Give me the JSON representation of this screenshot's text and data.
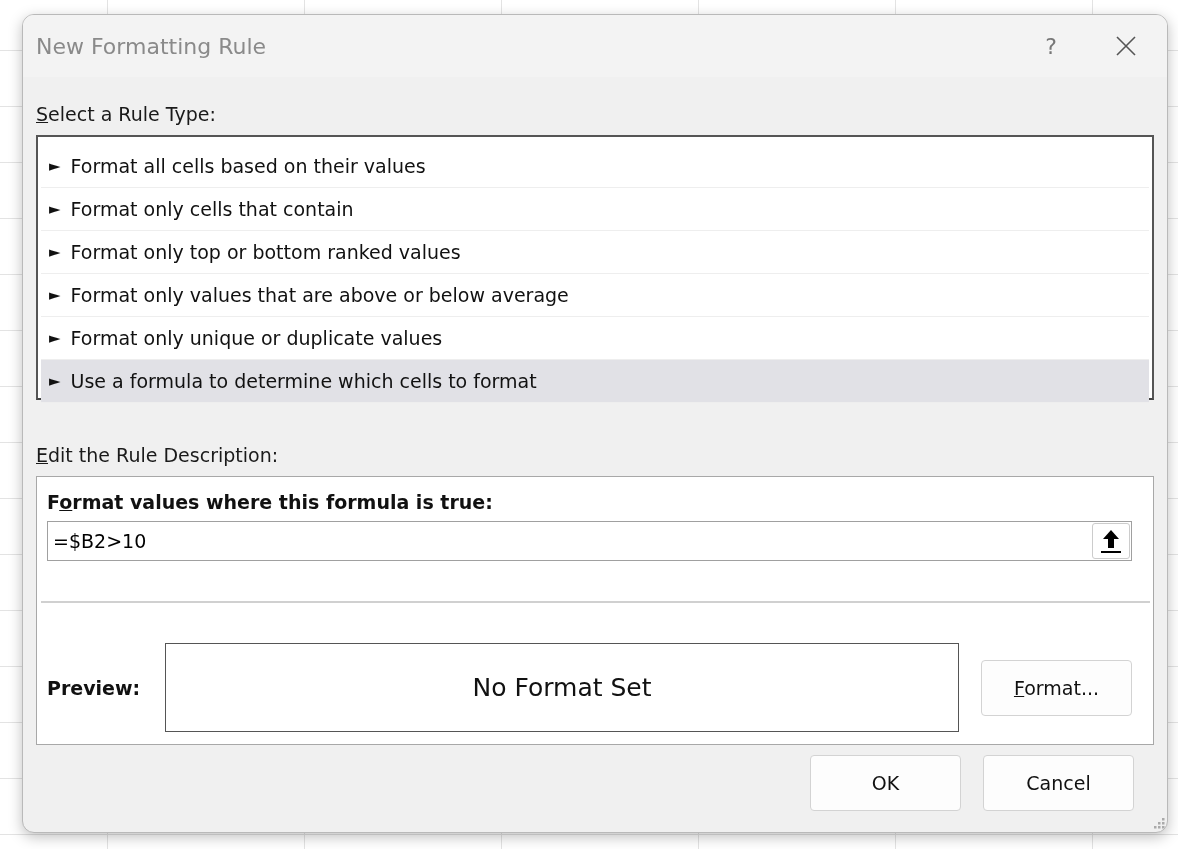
{
  "window": {
    "title": "New Formatting Rule",
    "help": "?"
  },
  "rule_type": {
    "label": {
      "key": "S",
      "post": "elect a Rule Type:"
    },
    "items": [
      {
        "label": "Format all cells based on their values",
        "selected": false
      },
      {
        "label": "Format only cells that contain",
        "selected": false
      },
      {
        "label": "Format only top or bottom ranked values",
        "selected": false
      },
      {
        "label": "Format only values that are above or below average",
        "selected": false
      },
      {
        "label": "Format only unique or duplicate values",
        "selected": false
      },
      {
        "label": "Use a formula to determine which cells to format",
        "selected": true
      }
    ],
    "bullet": "►"
  },
  "description": {
    "label": {
      "key": "E",
      "post": "dit the Rule Description:"
    },
    "formula_label": {
      "pre": "F",
      "key": "o",
      "post": "rmat values where this formula is true:"
    },
    "formula": "=$B2>10",
    "preview_label": "Preview:",
    "preview_text": "No Format Set",
    "format_button": {
      "key": "F",
      "post": "ormat..."
    }
  },
  "buttons": [
    "OK",
    "Cancel"
  ]
}
